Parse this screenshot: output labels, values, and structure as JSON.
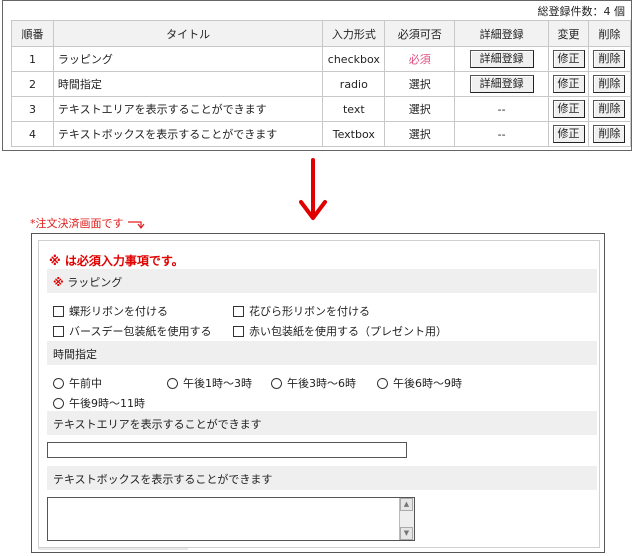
{
  "admin": {
    "total_count": "総登録件数：4 個",
    "columns": [
      "順番",
      "タイトル",
      "入力形式",
      "必須可否",
      "詳細登録",
      "変更",
      "削除"
    ],
    "rows": [
      {
        "order": "1",
        "title": "ラッピング",
        "type": "checkbox",
        "required": "必須",
        "detail": "詳細登録",
        "edit": "修正",
        "delete": "削除"
      },
      {
        "order": "2",
        "title": "時間指定",
        "type": "radio",
        "required": "選択",
        "detail": "詳細登録",
        "edit": "修正",
        "delete": "削除"
      },
      {
        "order": "3",
        "title": "テキストエリアを表示することができます",
        "type": "text",
        "required": "選択",
        "detail": "--",
        "edit": "修正",
        "delete": "削除"
      },
      {
        "order": "4",
        "title": "テキストボックスを表示することができます",
        "type": "Textbox",
        "required": "選択",
        "detail": "--",
        "edit": "修正",
        "delete": "削除"
      }
    ]
  },
  "note": "*注文決済画面です",
  "preview": {
    "required_note": "※ は必須入力事項です。",
    "required_mark": "※",
    "wrapping": {
      "title": "ラッピング",
      "options": [
        "蝶形リボンを付ける",
        "花びら形リボンを付ける",
        "バースデー包装紙を使用する",
        "赤い包装紙を使用する（プレゼント用）"
      ]
    },
    "time": {
      "title": "時間指定",
      "options": [
        "午前中",
        "午後1時～3時",
        "午後3時～6時",
        "午後6時～9時",
        "午後9時～11時"
      ]
    },
    "textarea_section": {
      "title": "テキストエリアを表示することができます"
    },
    "textbox_section": {
      "title": "テキストボックスを表示することができます"
    }
  },
  "colors": {
    "required": "#e00000",
    "accent_pink": "#e05080",
    "band": "#efefef"
  }
}
